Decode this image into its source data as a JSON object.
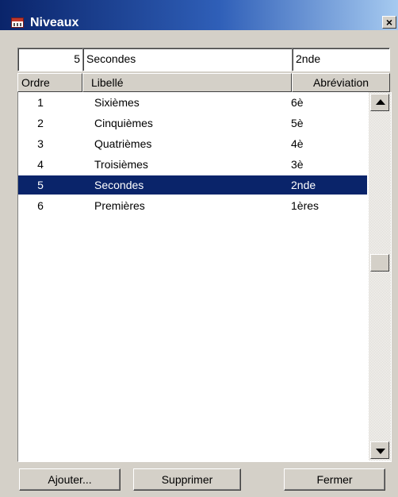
{
  "window": {
    "title": "Niveaux",
    "close_label": "×"
  },
  "edit": {
    "order": "5",
    "label": "Secondes",
    "abbreviation": "2nde"
  },
  "table": {
    "headers": {
      "order": "Ordre",
      "label": "Libellé",
      "abbreviation": "Abréviation"
    },
    "rows": [
      {
        "order": "1",
        "label": "Sixièmes",
        "abbreviation": "6è"
      },
      {
        "order": "2",
        "label": "Cinquièmes",
        "abbreviation": "5è"
      },
      {
        "order": "3",
        "label": "Quatrièmes",
        "abbreviation": "4è"
      },
      {
        "order": "4",
        "label": "Troisièmes",
        "abbreviation": "3è"
      },
      {
        "order": "5",
        "label": "Secondes",
        "abbreviation": "2nde"
      },
      {
        "order": "6",
        "label": "Premières",
        "abbreviation": "1ères"
      }
    ],
    "selected_row": "5"
  },
  "buttons": {
    "add": "Ajouter...",
    "delete": "Supprimer",
    "close": "Fermer"
  },
  "colors": {
    "title_bar": "#0a246a",
    "selection": "#0a246a",
    "window_bg": "#d4d0c8"
  }
}
